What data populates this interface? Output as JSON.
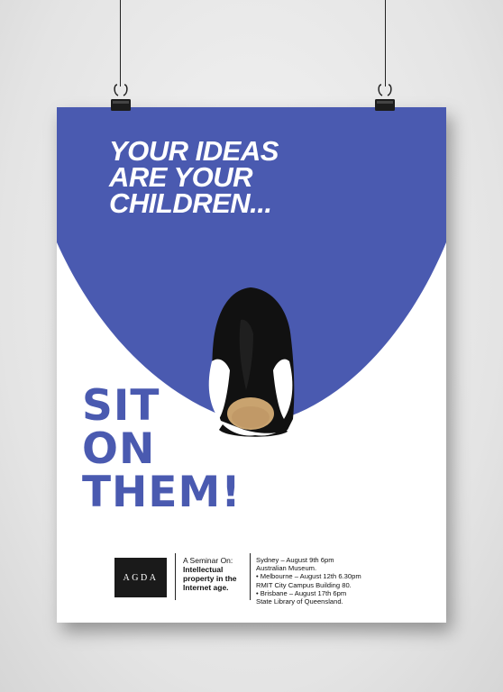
{
  "poster": {
    "headline": [
      "YOUR IDEAS",
      "ARE YOUR",
      "CHILDREN..."
    ],
    "cta": [
      "SIT",
      "ON",
      "THEM!"
    ],
    "logo_text": "AGDA",
    "seminar_intro": "A Seminar On:",
    "seminar_topic": [
      "Intellectual",
      "property in the",
      "Internet age."
    ],
    "dates": [
      "Sydney – August 9th 6pm",
      "Australian Museum.",
      "• Melbourne – August 12th 6.30pm",
      "RMIT City Campus Building 80.",
      "• Brisbane – August 17th 6pm",
      "State Library of Queensland."
    ]
  },
  "colors": {
    "blue": "#4a5ab0",
    "white": "#ffffff",
    "black": "#1a1a1a",
    "egg": "#c9a36f",
    "wall": "#e6e6e6"
  },
  "icons": [
    "binder-clip-icon",
    "penguin-illustration"
  ]
}
